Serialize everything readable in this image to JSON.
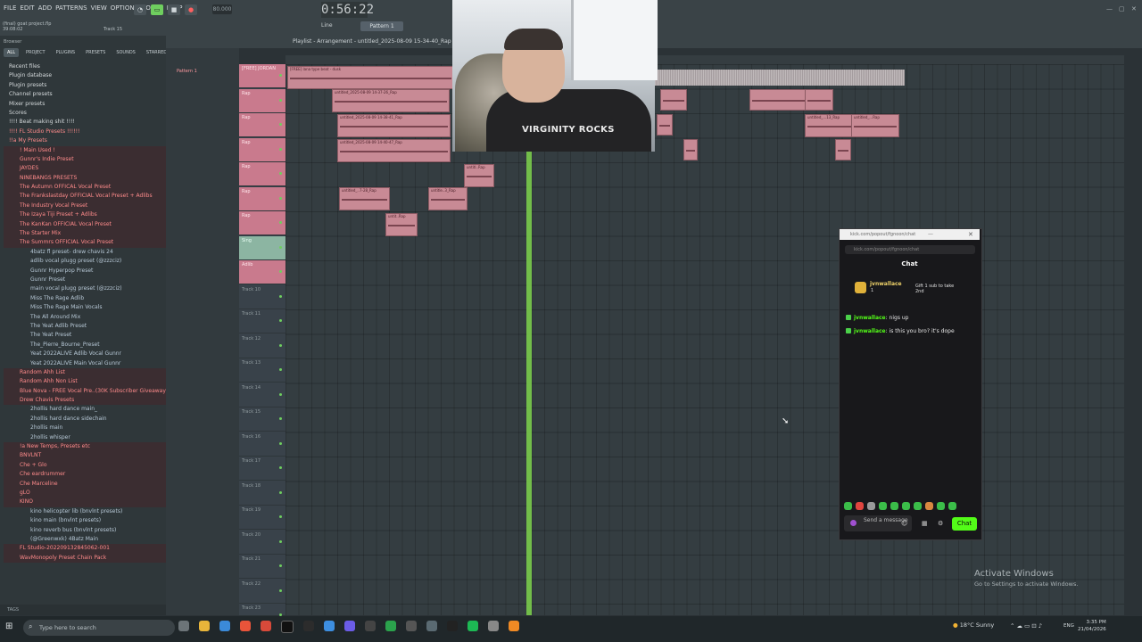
{
  "menu": [
    "FILE",
    "EDIT",
    "ADD",
    "PATTERNS",
    "VIEW",
    "OPTIONS",
    "TOOLS",
    "HELP"
  ],
  "project": {
    "name": "(final) goat project.flp",
    "time": "39:08:02"
  },
  "tempo": "80.000",
  "timer": "0:56:22",
  "pattern": "Pattern 1",
  "snap": "Line",
  "track_label": "Track 15",
  "browser": {
    "header": "Browser",
    "tabs": [
      "ALL",
      "PROJECT",
      "PLUGINS",
      "PRESETS",
      "SOUNDS",
      "STARRED"
    ],
    "items": [
      {
        "label": "Recent files",
        "style": "white"
      },
      {
        "label": "Plugin database",
        "style": "white"
      },
      {
        "label": "Plugin presets",
        "style": "white"
      },
      {
        "label": "Channel presets",
        "style": "white"
      },
      {
        "label": "Mixer presets",
        "style": "white"
      },
      {
        "label": "Scores",
        "style": "white"
      },
      {
        "label": "!!!!   Beat making shit  !!!!",
        "style": "white"
      },
      {
        "label": "!!!!   FL Studio Presets   !!!!!!",
        "style": "red"
      },
      {
        "label": "!!a My Presets",
        "style": "red"
      },
      {
        "label": "!  Main Used  !",
        "style": "red bar"
      },
      {
        "label": "Gunnr's Indie Preset",
        "style": "red bar"
      },
      {
        "label": "JAYDES",
        "style": "red bar"
      },
      {
        "label": "NINEBANGS PRESETS",
        "style": "red bar"
      },
      {
        "label": "The Autumn OFFICAL Vocal Preset",
        "style": "red bar"
      },
      {
        "label": "The Frankslastday OFFICIAL Vocal Preset + Adlibs",
        "style": "red bar"
      },
      {
        "label": "The Industry Vocal Preset",
        "style": "red bar"
      },
      {
        "label": "The Izaya Tiji Preset + Adlibs",
        "style": "red bar"
      },
      {
        "label": "The KanKan OFFICIAL Vocal Preset",
        "style": "red bar"
      },
      {
        "label": "The Starter Mix",
        "style": "red bar"
      },
      {
        "label": "The Summrs OFFICIAL Vocal Preset",
        "style": "red bar"
      },
      {
        "label": "4batz fl preset- drew chavis 24",
        "style": "plain"
      },
      {
        "label": "adlib vocal plugg preset (@zzzciz)",
        "style": "plain"
      },
      {
        "label": "Gunnr Hyperpop Preset",
        "style": "plain"
      },
      {
        "label": "Gunnr Preset",
        "style": "plain"
      },
      {
        "label": "main vocal plugg preset (@zzzciz)",
        "style": "plain"
      },
      {
        "label": "Miss The Rage Adlib",
        "style": "plain"
      },
      {
        "label": "Miss The Rage Main Vocals",
        "style": "plain"
      },
      {
        "label": "The All Around Mix",
        "style": "plain"
      },
      {
        "label": "The Yeat Adlib Preset",
        "style": "plain"
      },
      {
        "label": "The Yeat Preset",
        "style": "plain"
      },
      {
        "label": "The_Pierre_Bourne_Preset",
        "style": "plain"
      },
      {
        "label": "Yeat 2022ALIVE Adlib Vocal Gunnr",
        "style": "plain"
      },
      {
        "label": "Yeat 2022ALIVE Main Vocal Gunnr",
        "style": "plain"
      },
      {
        "label": "Random Ahh  List",
        "style": "red bar"
      },
      {
        "label": "Random Ahh Non  List",
        "style": "red bar"
      },
      {
        "label": "Blue Nova - FREE Vocal Pre..(30K Subscriber Giveaway)",
        "style": "red bar"
      },
      {
        "label": "Drew Chavis Presets",
        "style": "red bar"
      },
      {
        "label": "2hollis hard dance main_",
        "style": "plain"
      },
      {
        "label": "2hollis hard dance sidechain",
        "style": "plain"
      },
      {
        "label": "2hollis main",
        "style": "plain"
      },
      {
        "label": "2hollis whisper",
        "style": "plain"
      },
      {
        "label": "!a New Temps, Presets etc",
        "style": "red bar"
      },
      {
        "label": "BNVLNT",
        "style": "red bar"
      },
      {
        "label": "Che + Glo",
        "style": "red bar"
      },
      {
        "label": "Che eardrummer",
        "style": "red bar"
      },
      {
        "label": "Che Marceline",
        "style": "red bar"
      },
      {
        "label": "gLO",
        "style": "red bar"
      },
      {
        "label": "KINO",
        "style": "red bar"
      },
      {
        "label": "kino helicopter lib (bnvlnt presets)",
        "style": "plain"
      },
      {
        "label": "kino main (bnvlnt presets)",
        "style": "plain"
      },
      {
        "label": "kino reverb bus (bnvlnt presets)",
        "style": "plain"
      },
      {
        "label": "(@Greenwxk) 4Batz Main",
        "style": "plain"
      },
      {
        "label": "FL Studio-202209132845062-001",
        "style": "red bar"
      },
      {
        "label": "WavMonopoly Preset Chain Pack",
        "style": "red bar"
      }
    ],
    "tags_label": "TAGS"
  },
  "playlist": {
    "title": "Playlist - Arrangement - untitled_2025-08-09 15-34-40_Rap",
    "picker_item": "Pattern 1",
    "tracks": [
      {
        "label": "[FREE] JORDAN",
        "kind": "colored"
      },
      {
        "label": "Rap",
        "kind": "colored"
      },
      {
        "label": "Rap",
        "kind": "colored"
      },
      {
        "label": "Rap",
        "kind": "colored"
      },
      {
        "label": "Rap",
        "kind": "colored"
      },
      {
        "label": "Rap",
        "kind": "colored"
      },
      {
        "label": "Rap",
        "kind": "colored"
      },
      {
        "label": "Sing",
        "kind": "green"
      },
      {
        "label": "Adlib",
        "kind": "colored"
      },
      {
        "label": "Track 10",
        "kind": "empty"
      },
      {
        "label": "Track 11",
        "kind": "empty"
      },
      {
        "label": "Track 12",
        "kind": "empty"
      },
      {
        "label": "Track 13",
        "kind": "empty"
      },
      {
        "label": "Track 14",
        "kind": "empty"
      },
      {
        "label": "Track 15",
        "kind": "empty"
      },
      {
        "label": "Track 16",
        "kind": "empty"
      },
      {
        "label": "Track 17",
        "kind": "empty"
      },
      {
        "label": "Track 18",
        "kind": "empty"
      },
      {
        "label": "Track 19",
        "kind": "empty"
      },
      {
        "label": "Track 20",
        "kind": "empty"
      },
      {
        "label": "Track 21",
        "kind": "empty"
      },
      {
        "label": "Track 22",
        "kind": "empty"
      },
      {
        "label": "Track 23",
        "kind": "empty"
      }
    ],
    "clips": [
      {
        "label": "[FREE] lana type beat - dusk"
      },
      {
        "label": "untitled_2025-08-09 14-37-26_Rap"
      },
      {
        "label": "untitled_2025-08-09 14-38-41_Rap"
      },
      {
        "label": "untitled_2025-08-09 14-40-47_Rap"
      },
      {
        "label": "untitl..Rap"
      },
      {
        "label": "untitled_..7-28_Rap"
      },
      {
        "label": "untitle..3_Rap"
      },
      {
        "label": "untit..Rap"
      },
      {
        "label": "untitled_...13_Rap"
      },
      {
        "label": "untitled_...Rap"
      }
    ]
  },
  "chat": {
    "url": "kick.com/popout/fgnoon/chat",
    "url2": "kick.com/popout/fgnoon/chat",
    "title": "Chat",
    "top_gifter": "jvnwallace",
    "top_gifter_count": "1",
    "gift_text": "Gift 1 sub to take 2nd",
    "messages": [
      {
        "user": "jvnwallace",
        "text": ": nigs up"
      },
      {
        "user": "jvnwallace",
        "text": ": is this you bro? it's dope"
      }
    ],
    "input_placeholder": "Send a message",
    "send_label": "Chat"
  },
  "webcam": {
    "shirt_text": "VIRGINITY ROCKS"
  },
  "watermark": {
    "line1": "Activate Windows",
    "line2": "Go to Settings to activate Windows."
  },
  "taskbar": {
    "search_placeholder": "Type here to search",
    "weather": "18°C  Sunny",
    "lang": "ENG",
    "time": "3:35 PM",
    "date": "21/04/2026"
  },
  "colors": {
    "accent_green": "#53fc18",
    "clip_pink": "#c88a95",
    "playhead": "#7ed34c"
  }
}
